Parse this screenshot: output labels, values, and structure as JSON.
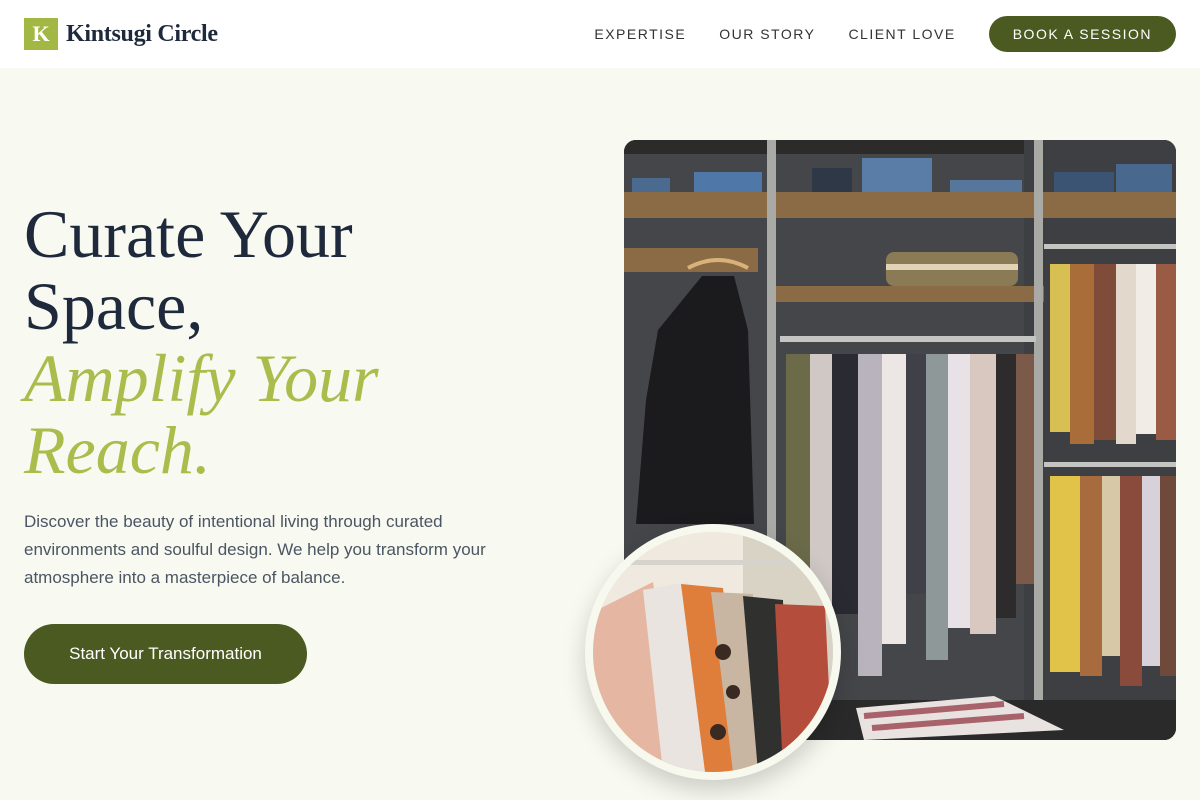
{
  "brand": {
    "mark": "K",
    "name": "Kintsugi Circle"
  },
  "nav": {
    "links": [
      "EXPERTISE",
      "OUR STORY",
      "CLIENT LOVE"
    ],
    "cta": "BOOK A SESSION"
  },
  "hero": {
    "title_line1": "Curate Your",
    "title_line2": "Space,",
    "accent_line1": "Amplify Your",
    "accent_line2": "Reach.",
    "subtitle": "Discover the beauty of intentional living through curated environments and soulful design. We help you transform your atmosphere into a masterpiece of balance.",
    "cta": "Start Your Transformation"
  },
  "images": {
    "main": "closet-with-hanging-clothes-photo",
    "circle": "clothing-rack-closeup-photo"
  },
  "colors": {
    "accent": "#aabd4c",
    "brand_mark": "#a3b844",
    "button": "#4a5a21",
    "background": "#f8f9f0"
  }
}
